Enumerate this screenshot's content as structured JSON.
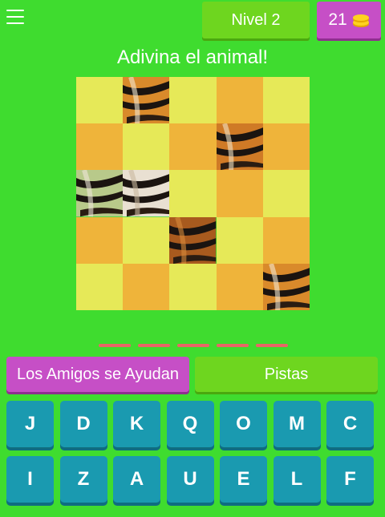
{
  "header": {
    "level_label": "Nivel 2",
    "coins": "21"
  },
  "title": "Adivina el animal!",
  "puzzle": {
    "grid": 5,
    "tiles": [
      "light",
      "reveal",
      "light",
      "dark",
      "light",
      "dark",
      "light",
      "dark",
      "reveal",
      "dark",
      "reveal",
      "reveal",
      "light",
      "dark",
      "light",
      "dark",
      "light",
      "reveal",
      "light",
      "dark",
      "light",
      "dark",
      "light",
      "dark",
      "reveal"
    ]
  },
  "answer_length": 5,
  "buttons": {
    "friends_label": "Los Amigos se Ayudan",
    "hints_label": "Pistas"
  },
  "keyboard": {
    "row1": [
      "J",
      "D",
      "K",
      "Q",
      "O",
      "M",
      "C"
    ],
    "row2": [
      "I",
      "Z",
      "A",
      "U",
      "E",
      "L",
      "F"
    ]
  },
  "colors": {
    "background": "#3fdc2f",
    "green_button": "#6ed61f",
    "purple_button": "#c64fc6",
    "key": "#1a9ab0",
    "tile_light": "#e6e958",
    "tile_dark": "#efb43a",
    "dash": "#e86767"
  }
}
